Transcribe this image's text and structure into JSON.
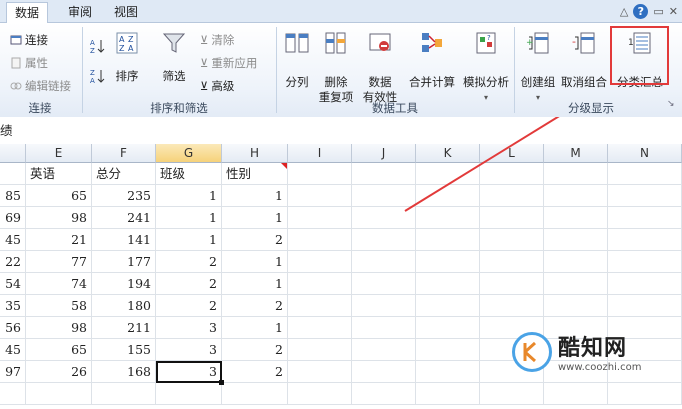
{
  "tabs": [
    {
      "label": "数据",
      "active": true
    },
    {
      "label": "审阅",
      "active": false
    },
    {
      "label": "视图",
      "active": false
    }
  ],
  "help_glyph": "?",
  "ribbon": {
    "connections": {
      "items": [
        "连接",
        "属性",
        "编辑链接"
      ],
      "group_label": "连接"
    },
    "sort_filter": {
      "sort_label": "排序",
      "filter_label": "筛选",
      "clear_label": "清除",
      "reapply_label": "重新应用",
      "advanced_label": "高级",
      "group_label": "排序和筛选"
    },
    "data_tools": {
      "text_to_columns": "分列",
      "remove_dup_line1": "删除",
      "remove_dup_line2": "重复项",
      "validation_line1": "数据",
      "validation_line2": "有效性",
      "consolidate": "合并计算",
      "what_if": "模拟分析",
      "group_label": "数据工具"
    },
    "outline": {
      "group": "创建组",
      "ungroup": "取消组合",
      "subtotal": "分类汇总",
      "group_label": "分级显示"
    }
  },
  "sheet": {
    "partial_row_text": "绩",
    "columns": [
      "E",
      "F",
      "G",
      "H",
      "I",
      "J",
      "K",
      "L",
      "M",
      "N"
    ],
    "selected_column": "G",
    "header_row": [
      "英语",
      "总分",
      "班级",
      "性别"
    ],
    "rows": [
      [
        "85",
        "65",
        "235",
        "1",
        "1"
      ],
      [
        "69",
        "98",
        "241",
        "1",
        "1"
      ],
      [
        "45",
        "21",
        "141",
        "1",
        "2"
      ],
      [
        "22",
        "77",
        "177",
        "2",
        "1"
      ],
      [
        "54",
        "74",
        "194",
        "2",
        "1"
      ],
      [
        "35",
        "58",
        "180",
        "2",
        "2"
      ],
      [
        "56",
        "98",
        "211",
        "3",
        "1"
      ],
      [
        "45",
        "65",
        "155",
        "3",
        "2"
      ],
      [
        "97",
        "26",
        "168",
        "3",
        "2"
      ]
    ]
  },
  "watermark": {
    "name": "酷知网",
    "url": "www.coozhi.com"
  },
  "colors": {
    "highlight": "#e23a3a",
    "ribbon_bg": "#eef3fa",
    "accent_blue": "#2f6fc1"
  }
}
